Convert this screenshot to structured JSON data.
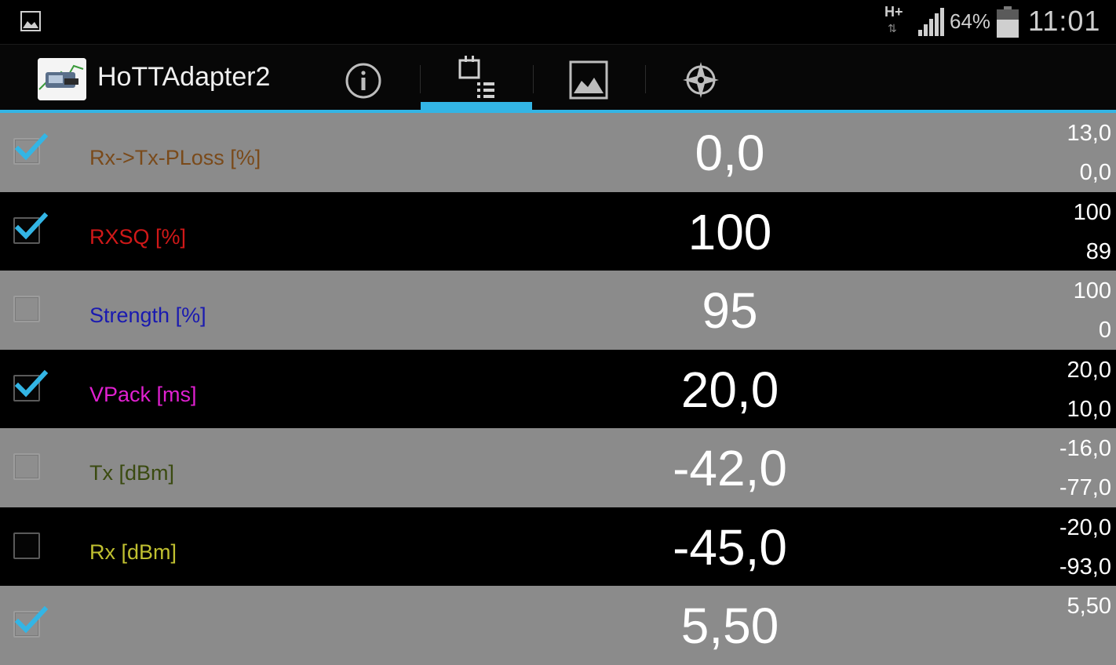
{
  "status_bar": {
    "network": "H+",
    "network_arrows": "⇅",
    "battery_percent": "64%",
    "time": "11:01"
  },
  "action_bar": {
    "app_title": "HoTTAdapter2",
    "tabs": [
      {
        "icon": "info-icon",
        "selected": false
      },
      {
        "icon": "sensor-list-icon",
        "selected": true
      },
      {
        "icon": "image-icon",
        "selected": false
      },
      {
        "icon": "gps-target-icon",
        "selected": false
      }
    ],
    "accent_color": "#33b5e5"
  },
  "rows": [
    {
      "label": "Rx->Tx-PLoss [%]",
      "checked": true,
      "value": "0,0",
      "max": "13,0",
      "min": "0,0",
      "color": "#7a4a1a"
    },
    {
      "label": "RXSQ [%]",
      "checked": true,
      "value": "100",
      "max": "100",
      "min": "89",
      "color": "#d01818"
    },
    {
      "label": "Strength [%]",
      "checked": false,
      "value": "95",
      "max": "100",
      "min": "0",
      "color": "#1a1ab0"
    },
    {
      "label": "VPack [ms]",
      "checked": true,
      "value": "20,0",
      "max": "20,0",
      "min": "10,0",
      "color": "#e020d0"
    },
    {
      "label": "Tx [dBm]",
      "checked": false,
      "value": "-42,0",
      "max": "-16,0",
      "min": "-77,0",
      "color": "#3a4a10"
    },
    {
      "label": "Rx [dBm]",
      "checked": false,
      "value": "-45,0",
      "max": "-20,0",
      "min": "-93,0",
      "color": "#c0c030"
    },
    {
      "label": "",
      "checked": true,
      "value": "5,50",
      "max": "5,50",
      "min": "",
      "color": "#1a8ad0"
    }
  ]
}
